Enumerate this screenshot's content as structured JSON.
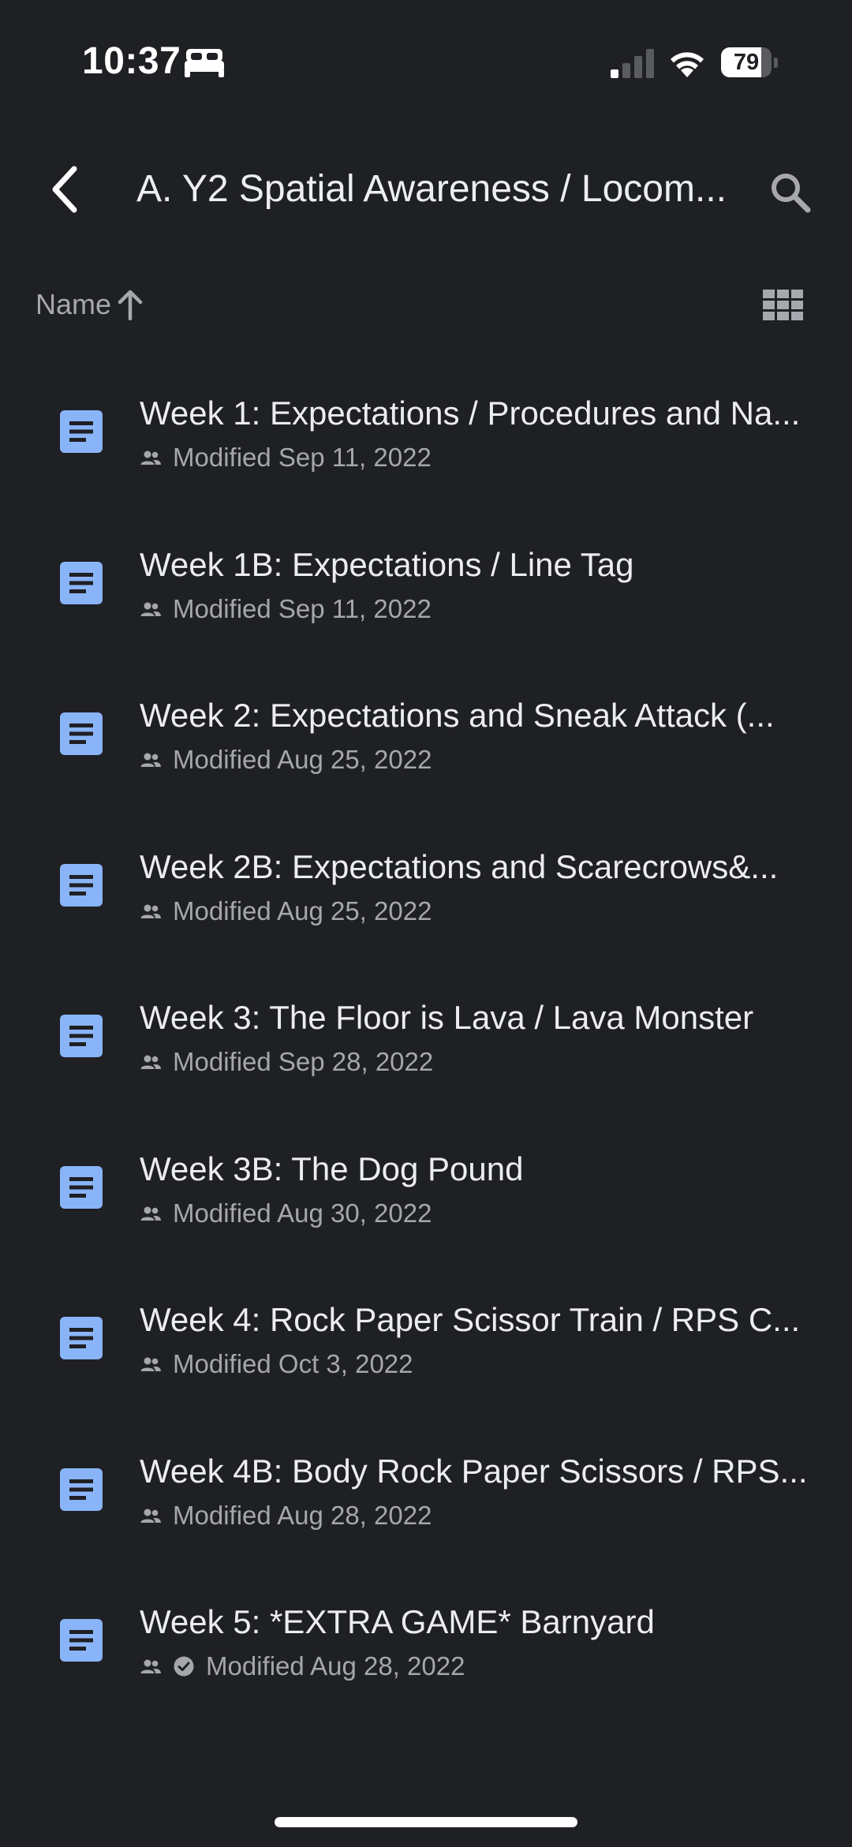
{
  "status_bar": {
    "time": "10:37",
    "battery_level": "79",
    "battery_fraction": 0.79
  },
  "header": {
    "folder_title": "A. Y2 Spatial Awareness / Locom...",
    "back_icon": "chevron-left-icon",
    "search_icon": "search-icon"
  },
  "sort": {
    "label": "Name",
    "direction_icon": "arrow-up-icon",
    "view_icon": "grid-view-icon"
  },
  "files": [
    {
      "name": "Week 1: Expectations / Procedures and Na...",
      "modified": "Modified Sep 11, 2022",
      "shared": true,
      "verified": false
    },
    {
      "name": "Week 1B: Expectations / Line Tag",
      "modified": "Modified Sep 11, 2022",
      "shared": true,
      "verified": false
    },
    {
      "name": "Week 2: Expectations and Sneak Attack (...",
      "modified": "Modified Aug 25, 2022",
      "shared": true,
      "verified": false
    },
    {
      "name": "Week 2B: Expectations and Scarecrows&...",
      "modified": "Modified Aug 25, 2022",
      "shared": true,
      "verified": false
    },
    {
      "name": "Week 3: The Floor is Lava / Lava Monster",
      "modified": "Modified Sep 28, 2022",
      "shared": true,
      "verified": false
    },
    {
      "name": "Week 3B: The Dog Pound",
      "modified": "Modified Aug 30, 2022",
      "shared": true,
      "verified": false
    },
    {
      "name": "Week 4: Rock Paper Scissor Train / RPS C...",
      "modified": "Modified Oct 3, 2022",
      "shared": true,
      "verified": false
    },
    {
      "name": "Week 4B: Body Rock Paper Scissors / RPS...",
      "modified": "Modified Aug 28, 2022",
      "shared": true,
      "verified": false
    },
    {
      "name": "Week 5: *EXTRA GAME* Barnyard",
      "modified": "Modified Aug 28, 2022",
      "shared": true,
      "verified": true
    }
  ],
  "colors": {
    "background": "#1f2024",
    "doc_icon": "#8ab4f8",
    "primary_text": "#ecedf0",
    "secondary_text": "#a5a7ab"
  }
}
